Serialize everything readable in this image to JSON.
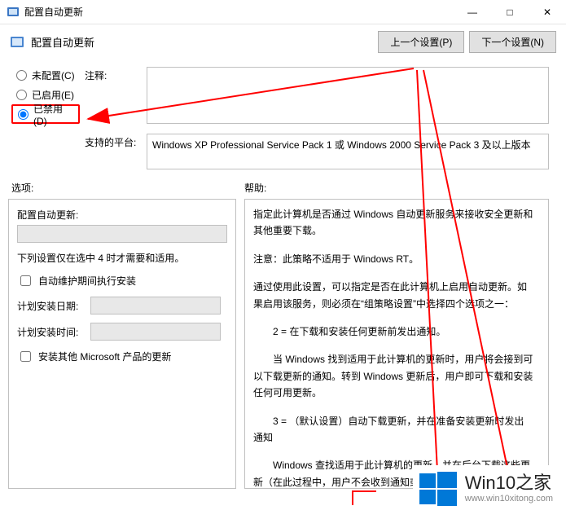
{
  "window": {
    "title": "配置自动更新",
    "minimize_glyph": "—",
    "maximize_glyph": "□",
    "close_glyph": "✕"
  },
  "header": {
    "title": "配置自动更新",
    "prev_btn": "上一个设置(P)",
    "next_btn": "下一个设置(N)"
  },
  "radios": {
    "not_configured": "未配置(C)",
    "enabled": "已启用(E)",
    "disabled": "已禁用(D)"
  },
  "labels": {
    "comment": "注释:",
    "platform": "支持的平台:",
    "options": "选项:",
    "help": "帮助:"
  },
  "platform_text": "Windows XP Professional Service Pack 1 或 Windows 2000 Service Pack 3 及以上版本",
  "options": {
    "configure_label": "配置自动更新:",
    "note": "下列设置仅在选中 4 时才需要和适用。",
    "auto_maint": "自动维护期间执行安装",
    "schedule_day": "计划安装日期:",
    "schedule_time": "计划安装时间:",
    "install_other": "安装其他 Microsoft 产品的更新"
  },
  "help": {
    "p1": "指定此计算机是否通过 Windows 自动更新服务来接收安全更新和其他重要下载。",
    "p2": "注意：此策略不适用于 Windows RT。",
    "p3": "通过使用此设置，可以指定是否在此计算机上启用自动更新。如果启用该服务，则必须在“组策略设置”中选择四个选项之一：",
    "p4": "2 = 在下载和安装任何更新前发出通知。",
    "p5": "当 Windows 找到适用于此计算机的更新时，用户将会接到可以下载更新的通知。转到 Windows 更新后，用户即可下载和安装任何可用更新。",
    "p6": "3 = （默认设置）自动下载更新，并在准备安装更新时发出通知",
    "p7": "Windows 查找适用于此计算机的更新，并在后台下载这些更新（在此过程中，用户不会收到通知或受到干扰）。完成下载后，将通知用户已到可以安装更新的通知。转到 Wi"
  },
  "watermark": {
    "title": "Win10之家",
    "url": "www.win10xitong.com"
  }
}
